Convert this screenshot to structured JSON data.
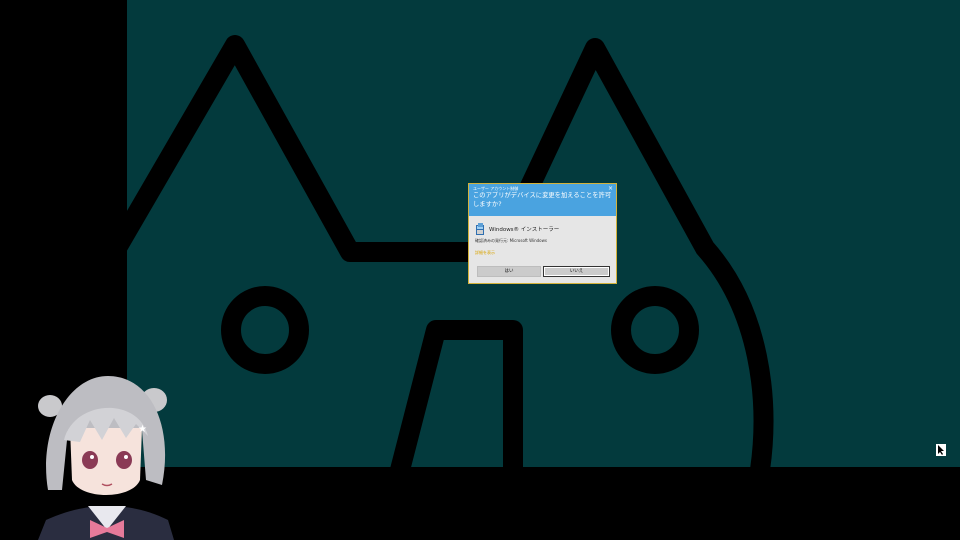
{
  "uac_dialog": {
    "caption": "ユーザー アカウント制御",
    "close_glyph": "×",
    "question": "このアプリがデバイスに変更を加えることを許可しますか?",
    "app_name": "Windows® インストーラー",
    "publisher": "確認済みの発行元: Microsoft Windows",
    "details_link": "詳細を表示",
    "yes_label": "はい",
    "no_label": "いいえ",
    "border_color": "#d4b23a",
    "header_color": "#4aa3e0"
  },
  "wallpaper": {
    "background_color": "#033a3d",
    "line_color": "#000000",
    "subject": "cat-face-line-art"
  },
  "overlay": {
    "avatar": "anime-girl-avatar",
    "corner_icon": "cursor-icon"
  }
}
